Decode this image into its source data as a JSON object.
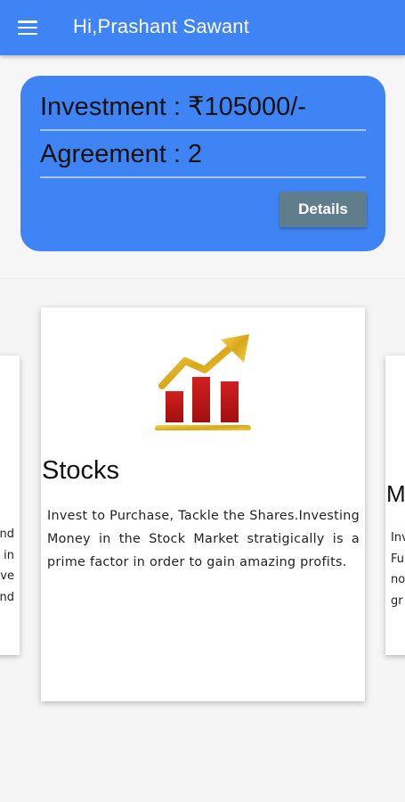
{
  "header": {
    "title": "Hi,Prashant Sawant",
    "menu_icon": "hamburger-menu-icon",
    "color": "#3f84f5"
  },
  "summary": {
    "investment": "Investment : ₹105000/-",
    "agreement": "Agreement : 2",
    "details_label": "Details",
    "details_color": "#607d8b"
  },
  "carousel": {
    "left_card_lines": "nd\nin\nve\nnd",
    "main_card": {
      "icon": "stock-chart-icon",
      "title": "Stocks",
      "description": "Invest to Purchase, Tackle the Shares.Investing Money in the Stock Market stratigically is a prime factor in order to gain amazing profits."
    },
    "right_card": {
      "title_fragment": "M",
      "lines": "Inv\nFu\nno\ngr"
    }
  }
}
